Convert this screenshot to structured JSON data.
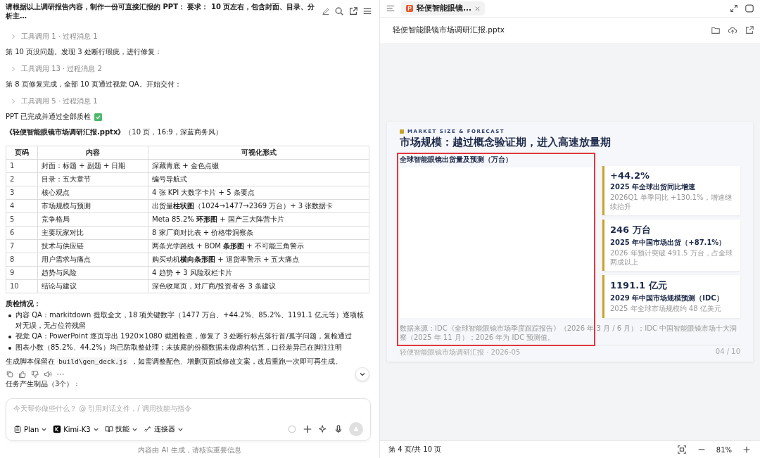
{
  "chat": {
    "title": "请根据以上调研报告内容，制作一份可直接汇报的 PPT： 要求： 10 页左右，包含封面、目录、分析主…",
    "messages": [
      {
        "kind": "tool-row",
        "text": "工具调用 1 · 过程消息 1"
      },
      {
        "kind": "text",
        "text": "第 10 页没问题。发现 3 处断行瑕疵，进行修复："
      },
      {
        "kind": "tool-row",
        "text": "工具调用 13 · 过程消息 2"
      },
      {
        "kind": "text",
        "text": "第 8 页修复完成，全部 10 页通过视觉 QA。开始交付："
      },
      {
        "kind": "tool-row",
        "text": "工具调用 5 · 过程消息 1"
      },
      {
        "kind": "check",
        "text": "PPT 已完成并通过全部质检"
      },
      {
        "kind": "text",
        "text": "**《轻便智能眼镜市场调研汇报.pptx》**（10 页，16:9，深蓝商务风）"
      }
    ],
    "table": {
      "columns": [
        "页码",
        "内容",
        "可视化形式"
      ],
      "rows": [
        [
          "1",
          "封面：标题 + 副题 + 日期",
          "深藏青底 + 金色点缀"
        ],
        [
          "2",
          "目录：五大章节",
          "编号导航式"
        ],
        [
          "3",
          "核心观点",
          "4 张 KPI 大数字卡片 + 5 条要点"
        ],
        [
          "4",
          "市场规模与预测",
          "出货量**柱状图**（1024→1477→2369 万台）+ 3 张数据卡"
        ],
        [
          "5",
          "竞争格局",
          "Meta 85.2% **环形图** + 国产三大阵营卡片"
        ],
        [
          "6",
          "主要玩家对比",
          "8 家厂商对比表 + 价格带洞察条"
        ],
        [
          "7",
          "技术与供应链",
          "两条光学路线 + BOM **条形图** + 不可能三角警示"
        ],
        [
          "8",
          "用户需求与痛点",
          "购买动机**横向条形图** + 退货率警示 + 五大痛点"
        ],
        [
          "9",
          "趋势与风险",
          "4 趋势 + 3 风险双栏卡片"
        ],
        [
          "10",
          "结论与建议",
          "深色收尾页，对厂商/投资者各 3 条建议"
        ]
      ]
    },
    "qa_heading": "质检情况：",
    "qa_items": [
      "内容 QA：markitdown 提取全文，18 项关键数字（1477 万台、+44.2%、85.2%、1191.1 亿元等）逐项核对无误，无占位符残留",
      "视觉 QA：PowerPoint 逐页导出 1920×1080 截图检查，修复了 3 处断行标点落行首/孤字问题，复检通过",
      "图表小数（85.2%、44.2%）均已防取整处理；未披露的份额数据未做虚构估算，口径差异已在脚注注明"
    ],
    "script_note": {
      "before": "生成脚本保留在",
      "code": "build\\gen_deck.js",
      "after": "，如需调整配色、增删页面或修改文案，改后重跑一次即可再生成。"
    },
    "artifacts_label": "任务产生制品（3个）：",
    "composer": {
      "placeholder": "今天帮你做些什么？ @ 引用对话文件，/ 调用技能与指令",
      "tools": [
        {
          "kind": "plan",
          "label": "Plan"
        },
        {
          "kind": "model",
          "label": "Kimi-K3"
        },
        {
          "kind": "skills",
          "label": "技能"
        },
        {
          "kind": "connectors",
          "label": "连接器"
        }
      ],
      "send_disabled": true
    },
    "disclaimer": "内容由 AI 生成，请核实重要信息"
  },
  "viewer": {
    "tab": {
      "label": "轻便智能眼镜...",
      "selected": true
    },
    "file_name": "轻便智能眼镜市场调研汇报.pptx",
    "slide": {
      "kicker": "MARKET SIZE & FORECAST",
      "title": "市场规模：越过概念验证期，进入高速放量期",
      "chart_title": "全球智能眼镜出货量及预测（万台）",
      "cards": [
        {
          "value": "+44.2%",
          "label": "2025 年全球出货同比增速",
          "note": "2026Q1 单季同比 +130.1%，增速继续抬升"
        },
        {
          "value": "246 万台",
          "label": "2025 年中国市场出货（+87.1%）",
          "note": "2026 年预计突破 491.5 万台，占全球两成以上"
        },
        {
          "value": "1191.1 亿元",
          "label": "2029 年中国市场规模预测（IDC）",
          "note": "2025 年全球市场规模约 48 亿美元"
        }
      ],
      "source": "数据来源：IDC《全球智能眼镜市场季度跟踪报告》（2026 年 3 月 / 6 月）；IDC 中国智能眼镜市场十大洞察（2025 年 11 月）；2026 年为 IDC 预测值。",
      "footer": "轻便智能眼镜市场调研汇报 · 2026-05",
      "page": "04 / 10",
      "highlighted": true
    },
    "page_status": "第 4 页/共 10 页",
    "zoom": "81%"
  }
}
